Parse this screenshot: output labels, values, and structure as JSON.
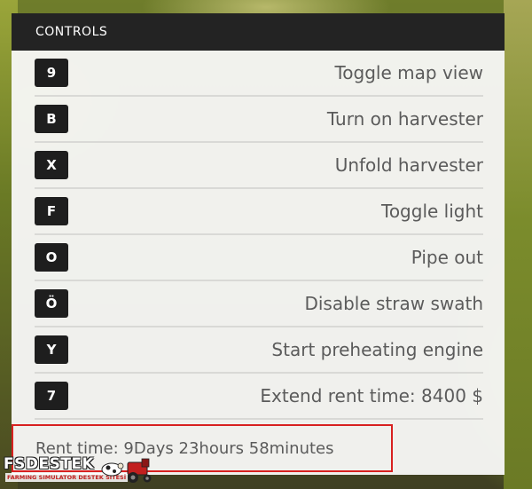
{
  "panel": {
    "title": "CONTROLS"
  },
  "controls": [
    {
      "key": "9",
      "label": "Toggle map view"
    },
    {
      "key": "B",
      "label": "Turn on harvester"
    },
    {
      "key": "X",
      "label": "Unfold harvester"
    },
    {
      "key": "F",
      "label": "Toggle light"
    },
    {
      "key": "O",
      "label": "Pipe out"
    },
    {
      "key": "Ö",
      "label": "Disable straw swath"
    },
    {
      "key": "Y",
      "label": "Start preheating engine"
    },
    {
      "key": "7",
      "label": "Extend rent time: 8400 $"
    }
  ],
  "rent": {
    "text": "Rent time: 9Days 23hours 58minutes"
  },
  "watermark": {
    "title": "FSDESTEK",
    "subtitle": "FARMING SIMULATOR DESTEK SİTESİ"
  },
  "colors": {
    "header_bg": "#232323",
    "key_bg": "#1e1e1e",
    "highlight_border": "#d82020"
  }
}
